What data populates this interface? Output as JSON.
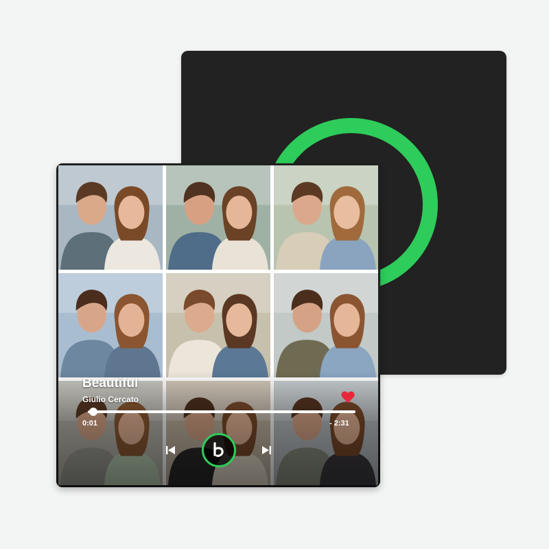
{
  "player": {
    "song_title": "Beautiful",
    "artist": "Giulio Cercato",
    "time_elapsed": "0:01",
    "time_remaining": "- 2:31",
    "progress_fraction": 0.02,
    "liked": true
  },
  "colors": {
    "accent_green": "#2ecc5a",
    "heart_red": "#e8283a",
    "sleeve": "#222222"
  },
  "icons": {
    "prev": "skip-previous-icon",
    "next": "skip-next-icon",
    "play": "brand-b-icon",
    "like": "heart-icon"
  },
  "photos": [
    {
      "bg": "#a8b7c2",
      "skin1": "#d9a98a",
      "skin2": "#e8b89c",
      "hair1": "#5a3a24",
      "hair2": "#7a4a28",
      "shirt1": "#5d6f78",
      "shirt2": "#ece7df"
    },
    {
      "bg": "#9fb1a4",
      "skin1": "#d8a083",
      "skin2": "#e6b698",
      "hair1": "#4f3220",
      "hair2": "#6a4226",
      "shirt1": "#4f6c88",
      "shirt2": "#e9e2d6"
    },
    {
      "bg": "#b8c4b0",
      "skin1": "#dba88b",
      "skin2": "#e9bea0",
      "hair1": "#5b3923",
      "hair2": "#a06a3c",
      "shirt1": "#d8cdb8",
      "shirt2": "#8aa4bf"
    },
    {
      "bg": "#a9bdd1",
      "skin1": "#d7a68a",
      "skin2": "#e4b396",
      "hair1": "#4a2d1c",
      "hair2": "#8a5530",
      "shirt1": "#6d87a0",
      "shirt2": "#5e7690"
    },
    {
      "bg": "#c7c0ad",
      "skin1": "#dcaa8c",
      "skin2": "#e7b99b",
      "hair1": "#7a4a2c",
      "hair2": "#5b3823",
      "shirt1": "#ece5da",
      "shirt2": "#5b7896"
    },
    {
      "bg": "#c2c9c7",
      "skin1": "#d5a285",
      "skin2": "#e6b698",
      "hair1": "#4c2e1d",
      "hair2": "#8b5532",
      "shirt1": "#6f6b52",
      "shirt2": "#8aa6c1"
    },
    {
      "bg": "#b6b3aa",
      "skin1": "#d8a688",
      "skin2": "#e6b597",
      "hair1": "#5a3824",
      "hair2": "#8d5a33",
      "shirt1": "#9d9c96",
      "shirt2": "#b9d0b5"
    },
    {
      "bg": "#c0b29f",
      "skin1": "#d6a386",
      "skin2": "#e5b597",
      "hair1": "#4d2f1e",
      "hair2": "#7b4b2b",
      "shirt1": "#2a2a2a",
      "shirt2": "#e2d9c8"
    },
    {
      "bg": "#b5bcc0",
      "skin1": "#d8a587",
      "skin2": "#e5b395",
      "hair1": "#553420",
      "hair2": "#7c4a2a",
      "shirt1": "#8a8f80",
      "shirt2": "#3d3a3f"
    }
  ]
}
